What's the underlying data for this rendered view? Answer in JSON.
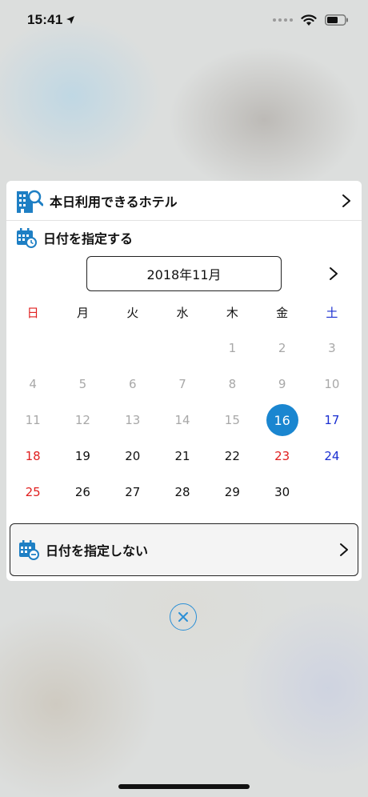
{
  "status_bar": {
    "time": "15:41",
    "location_icon": "location-arrow-icon",
    "wifi_icon": "wifi-icon",
    "battery_icon": "battery-icon"
  },
  "hotel_row": {
    "label": "本日利用できるホテル",
    "icon": "hotel-search-icon",
    "chevron": "chevron-right-icon"
  },
  "date_section": {
    "title": "日付を指定する",
    "icon": "calendar-clock-icon"
  },
  "calendar": {
    "month_label": "2018年11月",
    "next_icon": "chevron-right-icon",
    "weekdays": [
      "日",
      "月",
      "火",
      "水",
      "木",
      "金",
      "土"
    ],
    "weeks": [
      [
        "",
        "",
        "",
        "",
        "1",
        "2",
        "3"
      ],
      [
        "4",
        "5",
        "6",
        "7",
        "8",
        "9",
        "10"
      ],
      [
        "11",
        "12",
        "13",
        "14",
        "15",
        "16",
        "17"
      ],
      [
        "18",
        "19",
        "20",
        "21",
        "22",
        "23",
        "24"
      ],
      [
        "25",
        "26",
        "27",
        "28",
        "29",
        "30",
        ""
      ]
    ],
    "selected_day": "16",
    "colors": {
      "sunday": "#e02020",
      "saturday": "#1a2fd1",
      "past": "#a8a8a8",
      "selected": "#1a86d0"
    }
  },
  "no_date_button": {
    "label": "日付を指定しない",
    "icon": "calendar-minus-icon",
    "chevron": "chevron-right-icon"
  },
  "close_button": {
    "icon": "close-circle-icon",
    "color": "#2b8fd6"
  }
}
